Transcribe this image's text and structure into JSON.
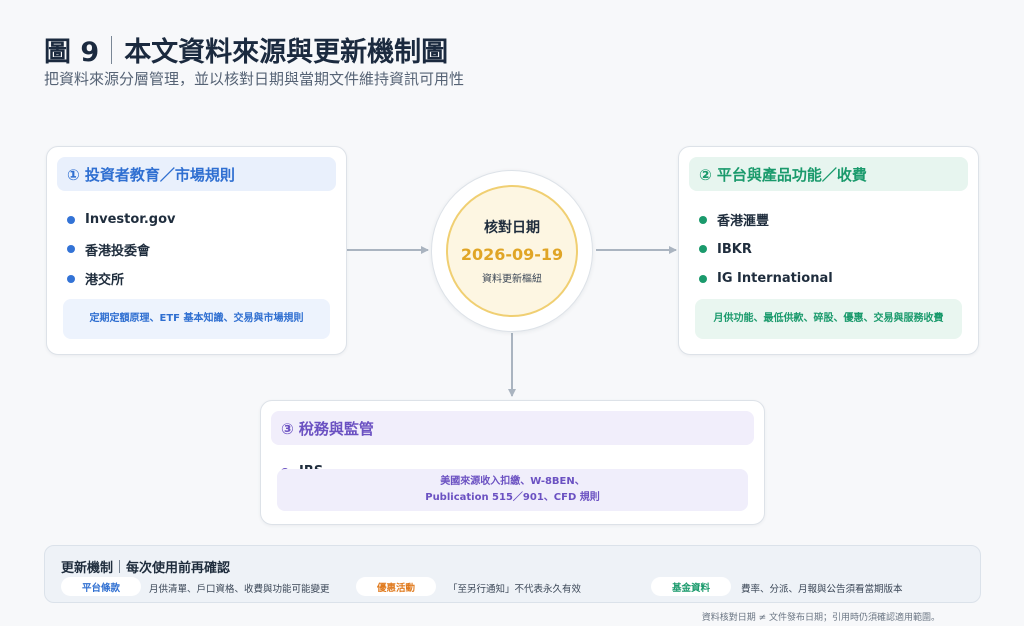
{
  "header": {
    "figure_label": "圖 9",
    "title": "本文資料來源與更新機制圖",
    "subtitle": "把資料來源分層管理，並以核對日期與當期文件維持資訊可用性"
  },
  "hub": {
    "label": "核對日期",
    "date": "2026-09-19",
    "sub": "資料更新樞紐",
    "accent": "#e0a526"
  },
  "cards": [
    {
      "title": "① 投資者教育／市場規則",
      "items": [
        "Investor.gov",
        "香港投委會",
        "港交所"
      ],
      "note": "定期定額原理、ETF 基本知識、交易與市場規則",
      "color": "#2f6fd1"
    },
    {
      "title": "② 平台與產品功能／收費",
      "items": [
        "香港滙豐",
        "IBKR",
        "IG International"
      ],
      "note": "月供功能、最低供款、碎股、優惠、交易與服務收費",
      "color": "#1a9a6c"
    },
    {
      "title": "③ 稅務與監管",
      "items": [
        "IRS"
      ],
      "note_line1": "美國來源收入扣繳、W-8BEN、",
      "note_line2": "Publication 515／901、CFD 規則",
      "color": "#6b51c2"
    }
  ],
  "update": {
    "title": "更新機制",
    "title_suffix": "每次使用前再確認",
    "chips": [
      {
        "label": "平台條款",
        "desc": "月供清單、戶口資格、收費與功能可能變更",
        "color": "#2f6fd1"
      },
      {
        "label": "優惠活動",
        "desc": "「至另行通知」不代表永久有效",
        "color": "#e07b1f"
      },
      {
        "label": "基金資料",
        "desc": "費率、分派、月報與公告須看當期版本",
        "color": "#1a9a6c"
      }
    ]
  },
  "footnote": "資料核對日期 ≠ 文件發布日期；引用時仍須確認適用範圍。"
}
